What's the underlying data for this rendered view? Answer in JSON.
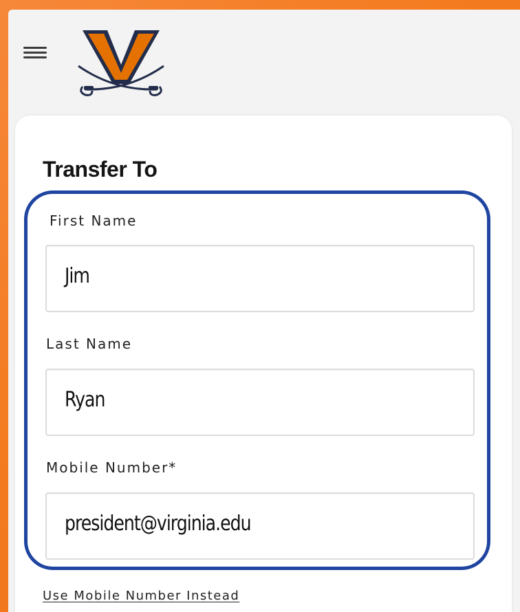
{
  "header": {
    "menu_icon": "hamburger-menu-icon",
    "logo_icon": "virginia-v-sabres-logo"
  },
  "form": {
    "title": "Transfer To",
    "fields": [
      {
        "label": "First Name",
        "value": "Jim"
      },
      {
        "label": "Last Name",
        "value": "Ryan"
      },
      {
        "label": "Mobile Number*",
        "value": "president@virginia.edu"
      }
    ],
    "alt_link": "Use Mobile Number Instead"
  },
  "colors": {
    "frame_orange": "#f47b20",
    "highlight_blue": "#1f45a0",
    "logo_orange": "#e57200",
    "logo_navy": "#232d4b"
  }
}
